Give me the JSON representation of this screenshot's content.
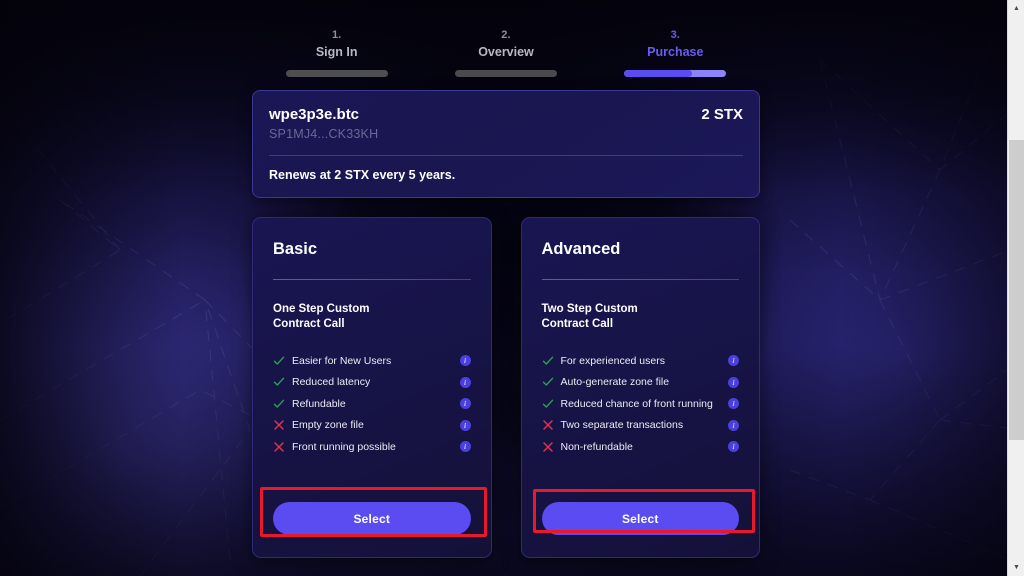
{
  "stepper": {
    "steps": [
      {
        "num": "1.",
        "label": "Sign In",
        "active": false
      },
      {
        "num": "2.",
        "label": "Overview",
        "active": false
      },
      {
        "num": "3.",
        "label": "Purchase",
        "active": true
      }
    ]
  },
  "domain_card": {
    "name": "wpe3p3e.btc",
    "address": "SP1MJ4...CK33KH",
    "price": "2 STX",
    "renewal": "Renews at 2 STX every 5 years."
  },
  "plans": [
    {
      "title": "Basic",
      "subtitle": "One Step Custom\nContract Call",
      "subtitle_line1": "One Step Custom",
      "subtitle_line2": "Contract Call",
      "features": [
        {
          "mark": "check",
          "text": "Easier for New Users",
          "info": "i"
        },
        {
          "mark": "check",
          "text": "Reduced latency",
          "info": "i"
        },
        {
          "mark": "check",
          "text": "Refundable",
          "info": "i"
        },
        {
          "mark": "cross",
          "text": "Empty zone file",
          "info": "i"
        },
        {
          "mark": "cross",
          "text": "Front running possible",
          "info": "i"
        }
      ],
      "button": "Select"
    },
    {
      "title": "Advanced",
      "subtitle_line1": "Two Step Custom",
      "subtitle_line2": "Contract Call",
      "features": [
        {
          "mark": "check",
          "text": "For experienced users",
          "info": "i"
        },
        {
          "mark": "check",
          "text": "Auto-generate zone file",
          "info": "i"
        },
        {
          "mark": "check",
          "text": "Reduced chance of front running",
          "info": "i"
        },
        {
          "mark": "cross",
          "text": "Two separate transactions",
          "info": "i"
        },
        {
          "mark": "cross",
          "text": "Non-refundable",
          "info": "i"
        }
      ],
      "button": "Select"
    }
  ],
  "scrollbar": {
    "up_arrow": "▲",
    "down_arrow": "▼"
  },
  "colors": {
    "accent": "#5a4cf0",
    "accent_light": "#8d82fa",
    "check": "#2f9e55",
    "cross": "#e0334b",
    "highlight": "#e8192c",
    "card_bg": "#191552",
    "page_bg": "#07061a"
  }
}
